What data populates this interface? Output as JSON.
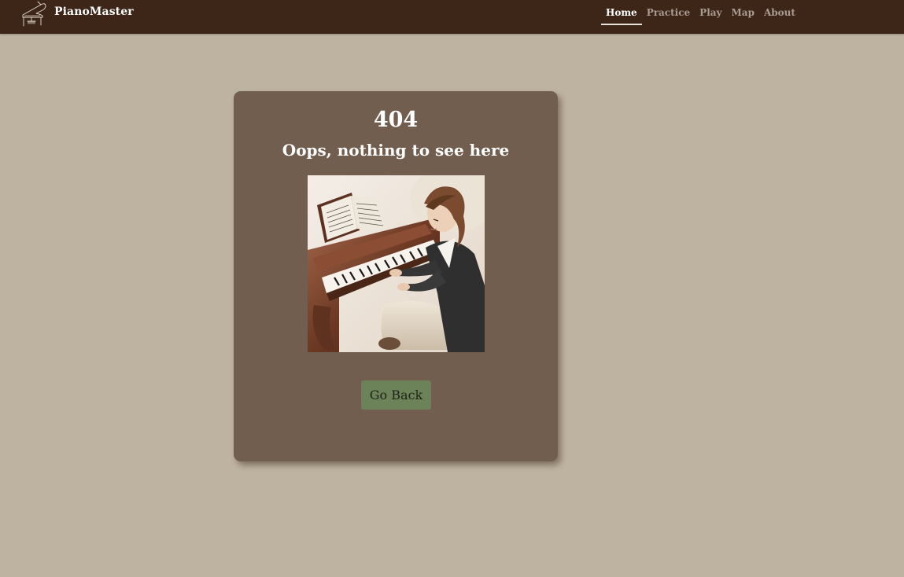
{
  "navbar": {
    "brand_name": "PianoMaster",
    "brand_icon": "piano-icon",
    "links": [
      {
        "label": "Home",
        "active": true
      },
      {
        "label": "Practice",
        "active": false
      },
      {
        "label": "Play",
        "active": false
      },
      {
        "label": "Map",
        "active": false
      },
      {
        "label": "About",
        "active": false
      }
    ]
  },
  "error": {
    "code": "404",
    "message": "Oops, nothing to see here",
    "illustration": "woman-playing-piano-illustration",
    "button_label": "Go Back"
  },
  "colors": {
    "page_background": "#beb3a0",
    "navbar_background": "#3d2518",
    "card_background": "#715e4f",
    "button_background": "#6c8258",
    "active_link": "#ffffff",
    "inactive_link": "#a99c93"
  }
}
